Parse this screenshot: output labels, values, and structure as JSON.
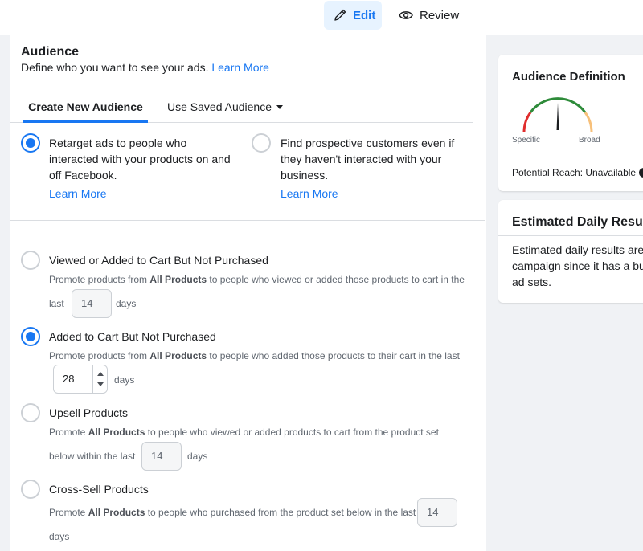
{
  "topbar": {
    "edit_label": "Edit",
    "review_label": "Review"
  },
  "audience": {
    "title": "Audience",
    "subtitle": "Define who you want to see your ads.",
    "subtitle_link": "Learn More",
    "tabs": {
      "create_new": "Create New Audience",
      "use_saved": "Use Saved Audience"
    },
    "options": [
      {
        "text": "Retarget ads to people who interacted with your products on and off Facebook.",
        "link": "Learn More",
        "selected": true
      },
      {
        "text": "Find prospective customers even if they haven't interacted with your business.",
        "link": "Learn More",
        "selected": false
      }
    ],
    "retarget": [
      {
        "title": "Viewed or Added to Cart But Not Purchased",
        "desc_a": "Promote products from ",
        "desc_bold": "All Products",
        "desc_b": " to people who viewed or added those products to cart in the",
        "desc_c": "last",
        "days_value": "14",
        "days_label": "days",
        "selected": false
      },
      {
        "title": "Added to Cart But Not Purchased",
        "desc_a": "Promote products from ",
        "desc_bold": "All Products",
        "desc_b": " to people who added those products to their cart in the last",
        "days_value": "28",
        "days_label": "days",
        "selected": true
      },
      {
        "title": "Upsell Products",
        "desc_a": "Promote ",
        "desc_bold": "All Products",
        "desc_b": " to people who viewed or added products to cart from the product set",
        "desc_c": "below within the last",
        "days_value": "14",
        "days_label": "days",
        "selected": false
      },
      {
        "title": "Cross-Sell Products",
        "desc_a": "Promote ",
        "desc_bold": "All Products",
        "desc_b": " to people who purchased from the product set below in the last",
        "days_value": "14",
        "days_label": "days",
        "selected": false
      }
    ]
  },
  "definition": {
    "title": "Audience Definition",
    "specific_label": "Specific",
    "broad_label": "Broad",
    "reach_label": "Potential Reach: Unavailable",
    "info_glyph": "i"
  },
  "estimated": {
    "title": "Estimated Daily Results",
    "line1": "Estimated daily results are",
    "line2": "campaign since it has a bu",
    "line3": "ad sets."
  },
  "colors": {
    "accent": "#1877f2",
    "gauge_red": "#e02d2d",
    "gauge_green": "#2e8b3a",
    "gauge_orange": "#f7c07a"
  }
}
